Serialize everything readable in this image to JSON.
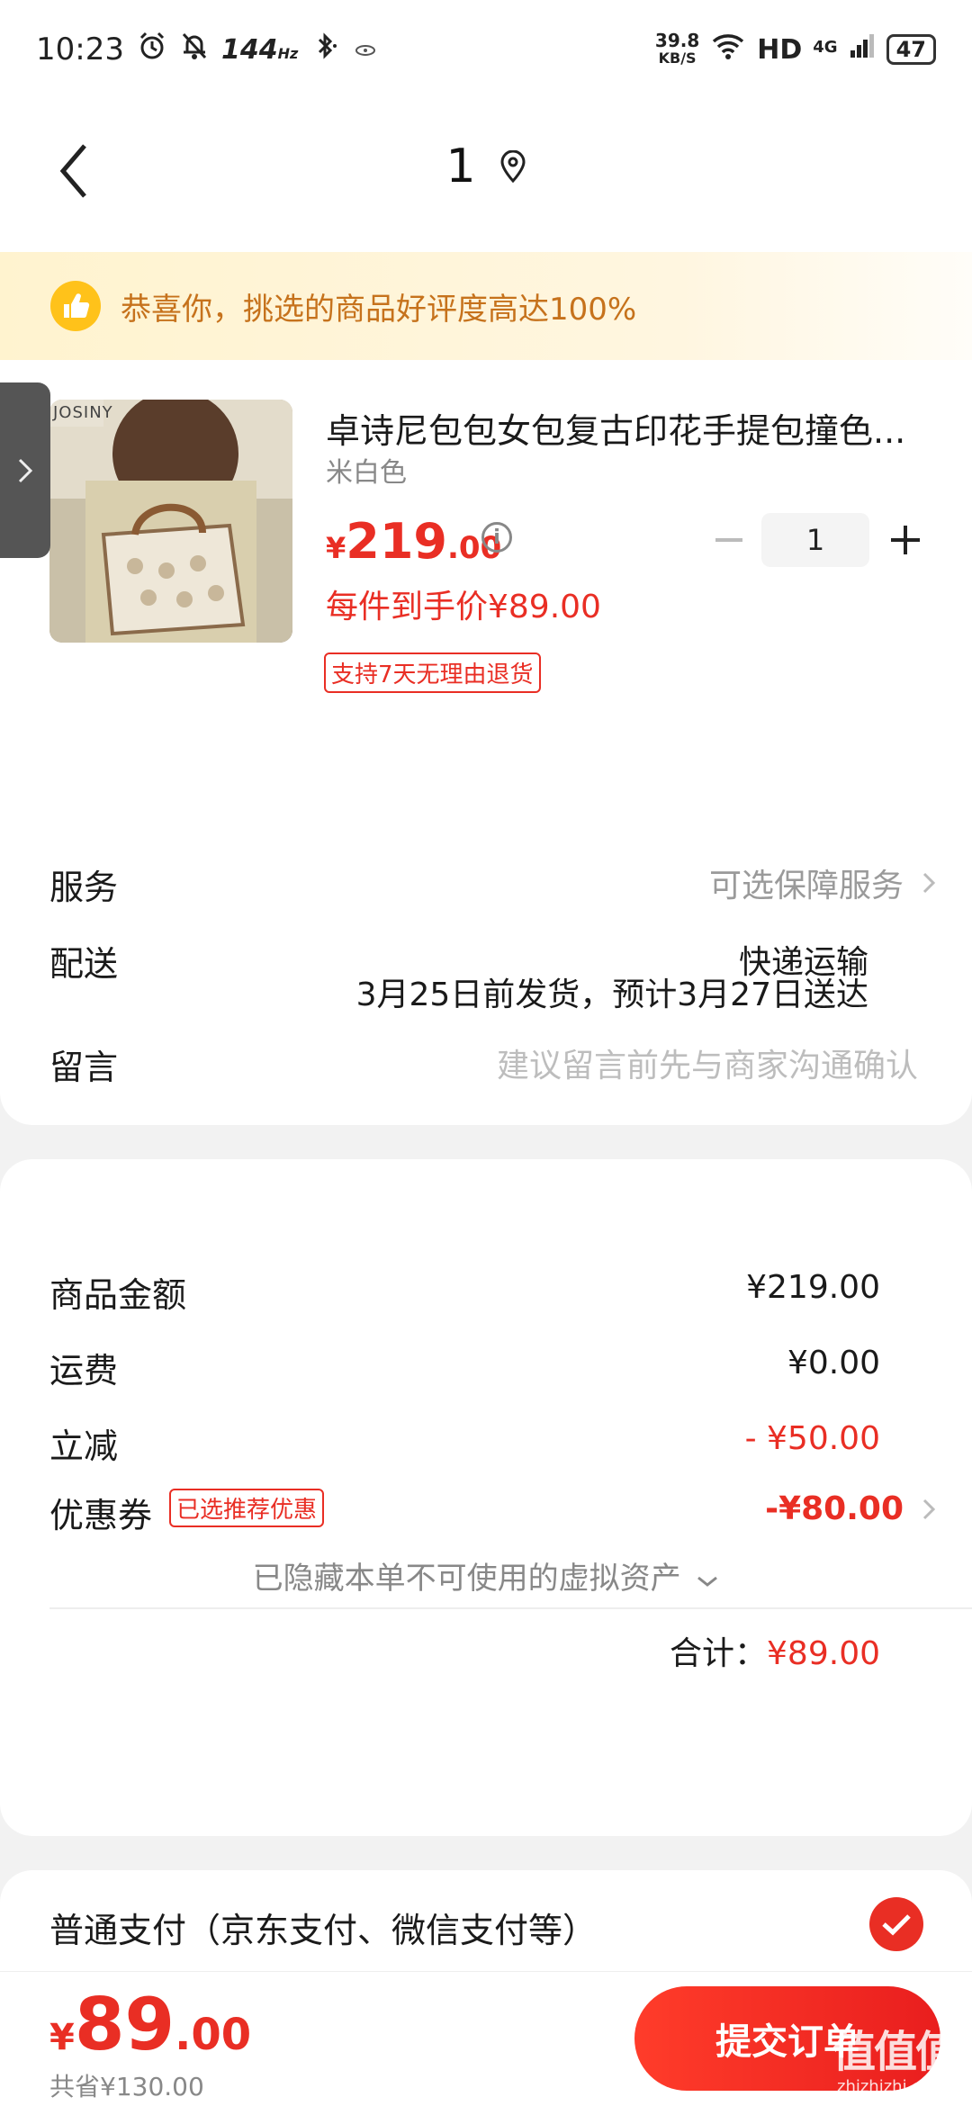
{
  "status_bar": {
    "time": "10:23",
    "refresh_rate": "144",
    "refresh_unit": "Hz",
    "net_speed_value": "39.8",
    "net_speed_unit": "KB/S",
    "hd_label": "HD",
    "network_type": "4G",
    "battery": "47"
  },
  "header": {
    "title": "1"
  },
  "banner": {
    "text": "恭喜你，挑选的商品好评度高达100%"
  },
  "product": {
    "title": "卓诗尼包包女包复古印花手提包撞色...",
    "variant": "米白色",
    "price_currency": "¥",
    "price_integer": "219",
    "price_decimal": ".00",
    "quantity": "1",
    "unit_price_text": "每件到手价¥89.00",
    "return_tag": "支持7天无理由退货",
    "image_brand_text": "JOSINY"
  },
  "rows": {
    "service_label": "服务",
    "service_value": "可选保障服务",
    "delivery_label": "配送",
    "delivery_method": "快递运输",
    "delivery_time": "3月25日前发货，预计3月27日送达",
    "message_label": "留言",
    "message_placeholder": "建议留言前先与商家沟通确认"
  },
  "summary": {
    "goods_label": "商品金额",
    "goods_value": "¥219.00",
    "shipping_label": "运费",
    "shipping_value": "¥0.00",
    "discount_label": "立减",
    "discount_value": "- ¥50.00",
    "coupon_label": "优惠券",
    "coupon_tag": "已选推荐优惠",
    "coupon_value": "-¥80.00",
    "hidden_assets": "已隐藏本单不可使用的虚拟资产",
    "total_label": "合计：",
    "total_value": "¥89.00"
  },
  "payment": {
    "method": "普通支付（京东支付、微信支付等）"
  },
  "bottom": {
    "price_currency": "¥",
    "price_integer": "89",
    "price_decimal": ".00",
    "saved": "共省¥130.00",
    "submit_label": "提交订单"
  },
  "watermark": {
    "text": "值值值",
    "small": "zhizhizhi.com"
  },
  "colors": {
    "accent_red": "#e92e24",
    "banner_text": "#c6721c",
    "banner_icon": "#ffc21a"
  }
}
